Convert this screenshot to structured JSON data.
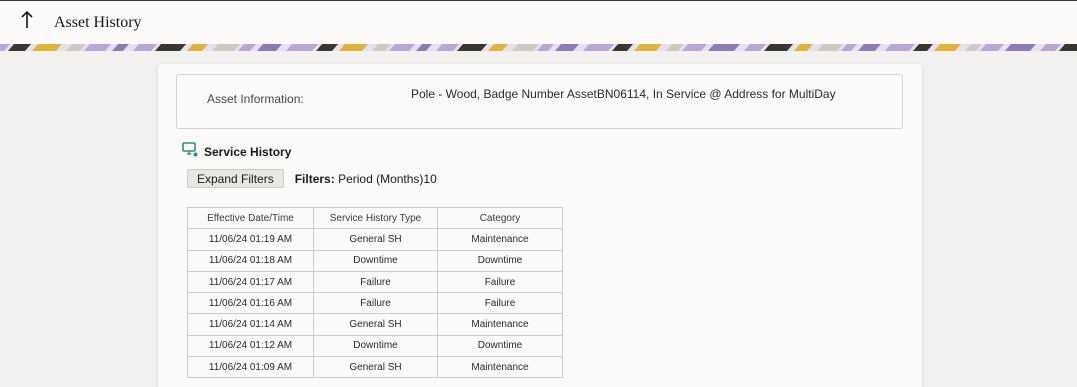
{
  "header": {
    "title": "Asset History"
  },
  "asset": {
    "label": "Asset Information:",
    "value": "Pole - Wood, Badge Number AssetBN06114, In Service @ Address for MultiDay"
  },
  "service_history": {
    "title": "Service History",
    "expand_filters_label": "Expand Filters",
    "filters_label": "Filters:",
    "filters_value": "Period (Months)10",
    "columns": [
      "Effective Date/Time",
      "Service History Type",
      "Category"
    ],
    "rows": [
      [
        "11/06/24 01:19 AM",
        "General SH",
        "Maintenance"
      ],
      [
        "11/06/24 01:18 AM",
        "Downtime",
        "Downtime"
      ],
      [
        "11/06/24 01:17 AM",
        "Failure",
        "Failure"
      ],
      [
        "11/06/24 01:16 AM",
        "Failure",
        "Failure"
      ],
      [
        "11/06/24 01:14 AM",
        "General SH",
        "Maintenance"
      ],
      [
        "11/06/24 01:12 AM",
        "Downtime",
        "Downtime"
      ],
      [
        "11/06/24 01:09 AM",
        "General SH",
        "Maintenance"
      ]
    ]
  },
  "icons": {
    "back": "arrow-up-icon",
    "section": "monitor-icon"
  },
  "colors": {
    "section_icon": "#2f8f83",
    "banner_purple": "#b9a6d6",
    "banner_gold": "#e0b43a",
    "banner_dark": "#3a3632"
  }
}
